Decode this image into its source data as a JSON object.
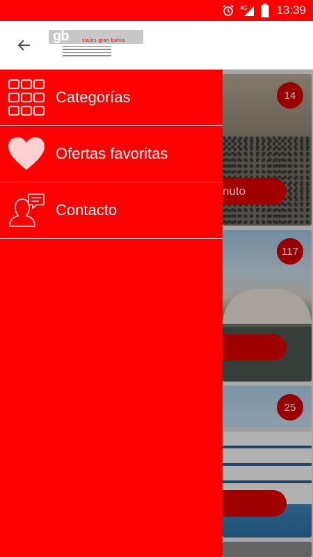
{
  "status_bar": {
    "time": "13:39",
    "network_label": "4G",
    "icons": [
      "alarm-icon",
      "signal-icon",
      "battery-icon"
    ]
  },
  "app_bar": {
    "back_icon": "arrow-left-icon",
    "logo": {
      "monogram": "gb",
      "name": "viajes gran bahia"
    }
  },
  "drawer": {
    "items": [
      {
        "label": "Categorías",
        "icon": "grid-icon"
      },
      {
        "label": "Ofertas favoritas",
        "icon": "heart-icon"
      },
      {
        "label": "Contacto",
        "icon": "contact-person-icon"
      }
    ]
  },
  "background_cards": [
    {
      "count": "14",
      "pill_text": "nuto"
    },
    {
      "count": "117",
      "pill_text": ""
    },
    {
      "count": "25",
      "pill_text": ""
    }
  ],
  "colors": {
    "primary": "#ff0000",
    "badge": "#d10000",
    "divider": "#ffd2d2"
  }
}
